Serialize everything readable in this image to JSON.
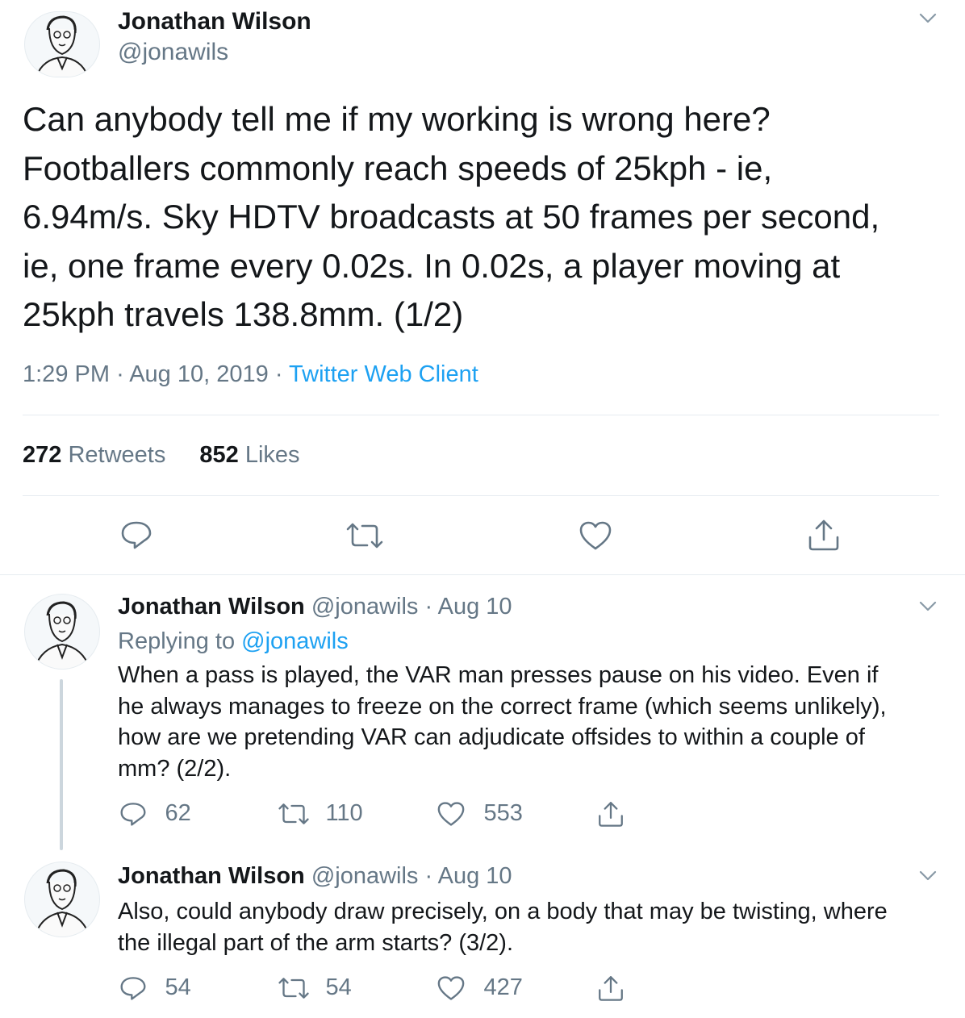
{
  "main_tweet": {
    "author_name": "Jonathan Wilson",
    "author_handle": "@jonawils",
    "text_lines": [
      "Can anybody tell me if my working is wrong here?",
      "Footballers commonly reach speeds of 25kph - ie,",
      "6.94m/s. Sky HDTV broadcasts at 50 frames per second,",
      "ie, one frame every 0.02s. In 0.02s, a player moving at",
      "25kph travels 138.8mm. (1/2)"
    ],
    "time": "1:29 PM",
    "date": "Aug 10, 2019",
    "separator": "·",
    "client": "Twitter Web Client",
    "retweets_count": "272",
    "retweets_label": "Retweets",
    "likes_count": "852",
    "likes_label": "Likes"
  },
  "replies": [
    {
      "author_name": "Jonathan Wilson",
      "author_handle": "@jonawils",
      "separator": "·",
      "date": "Aug 10",
      "replying_to_label": "Replying to",
      "replying_to_handle": "@jonawils",
      "text_lines": [
        "When a pass is played, the VAR man presses pause on his video. Even if",
        "he always manages to freeze on the correct frame (which seems unlikely),",
        "how are we pretending VAR can adjudicate offsides to within a couple of",
        "mm? (2/2)."
      ],
      "reply_count": "62",
      "retweet_count": "110",
      "like_count": "553"
    },
    {
      "author_name": "Jonathan Wilson",
      "author_handle": "@jonawils",
      "separator": "·",
      "date": "Aug 10",
      "text_lines": [
        "Also, could anybody draw precisely, on a body that may be twisting, where",
        "the illegal part of the arm starts? (3/2)."
      ],
      "reply_count": "54",
      "retweet_count": "54",
      "like_count": "427"
    }
  ],
  "colors": {
    "link": "#1da1f2",
    "muted": "#657786",
    "text": "#14171a",
    "divider": "#e6ecf0"
  },
  "icons": [
    "avatar-illustration",
    "chevron-down-icon",
    "reply-icon",
    "retweet-icon",
    "like-icon",
    "share-icon"
  ]
}
